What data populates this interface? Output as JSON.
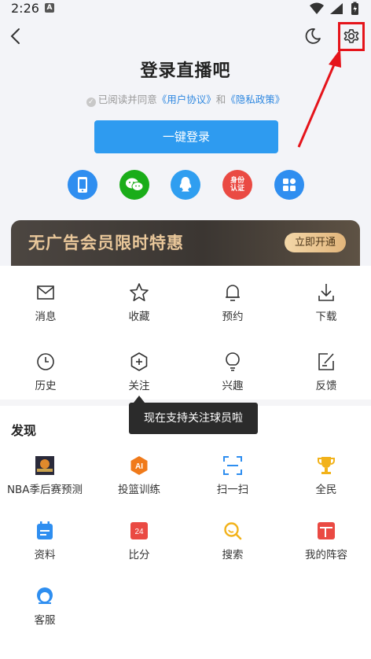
{
  "status_bar": {
    "time": "2:26",
    "notif_icon_letter": "A",
    "icons": [
      "wifi-icon",
      "signal-icon",
      "battery-icon"
    ]
  },
  "header": {
    "back_icon": "chevron-left-icon",
    "night_icon": "moon-icon",
    "settings_icon": "gear-icon"
  },
  "login": {
    "title": "登录直播吧",
    "agree_prefix": "已阅读并同意",
    "user_agreement": "《用户协议》",
    "and": "和",
    "privacy_policy": "《隐私政策》",
    "button_label": "一键登录",
    "social": [
      {
        "name": "phone-login",
        "icon": "phone-icon",
        "color": "#2f8ef0"
      },
      {
        "name": "wechat-login",
        "icon": "wechat-icon",
        "color": "#1aad19"
      },
      {
        "name": "qq-login",
        "icon": "qq-icon",
        "color": "#2f9ef0"
      },
      {
        "name": "id-verify-login",
        "icon": "id-card-icon",
        "color": "#ea4a43",
        "label": "身份认证"
      },
      {
        "name": "more-login",
        "icon": "grid-icon",
        "color": "#2f8ef0"
      }
    ]
  },
  "vip_banner": {
    "text": "无广告会员限时特惠",
    "button": "立即开通"
  },
  "menu": [
    {
      "label": "消息",
      "icon": "mail-icon"
    },
    {
      "label": "收藏",
      "icon": "star-icon"
    },
    {
      "label": "预约",
      "icon": "bell-icon"
    },
    {
      "label": "下载",
      "icon": "download-icon"
    },
    {
      "label": "历史",
      "icon": "clock-icon"
    },
    {
      "label": "关注",
      "icon": "hexagon-plus-icon"
    },
    {
      "label": "兴趣",
      "icon": "lightbulb-icon"
    },
    {
      "label": "反馈",
      "icon": "edit-icon"
    }
  ],
  "tooltip": "现在支持关注球员啦",
  "discover": {
    "title": "发现",
    "items": [
      {
        "label": "NBA季后赛预测",
        "icon": "nba-playoff-icon"
      },
      {
        "label": "投篮训练",
        "icon": "ai-shooting-icon"
      },
      {
        "label": "扫一扫",
        "icon": "scan-icon"
      },
      {
        "label": "全民",
        "icon": "trophy-icon"
      },
      {
        "label": "资料",
        "icon": "calendar-icon"
      },
      {
        "label": "比分",
        "icon": "score-icon",
        "badge": "24"
      },
      {
        "label": "搜索",
        "icon": "search-icon"
      },
      {
        "label": "我的阵容",
        "icon": "lineup-icon"
      },
      {
        "label": "客服",
        "icon": "customer-service-icon"
      }
    ]
  },
  "colors": {
    "accent": "#2e9bf0",
    "highlight": "#e5141b",
    "link": "#2f88e0",
    "vip_gold": "#e9c79a"
  }
}
